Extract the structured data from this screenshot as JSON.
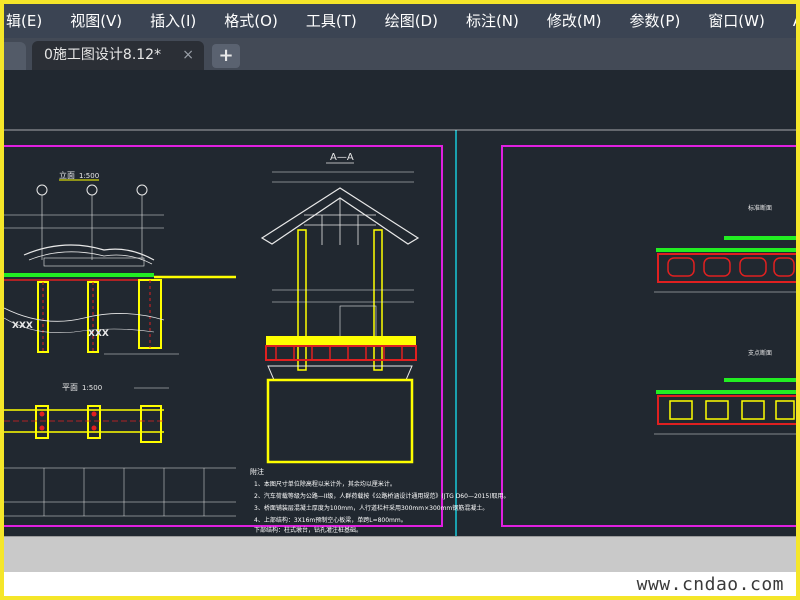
{
  "menu": {
    "items": [
      "辑(E)",
      "视图(V)",
      "插入(I)",
      "格式(O)",
      "工具(T)",
      "绘图(D)",
      "标注(N)",
      "修改(M)",
      "参数(P)",
      "窗口(W)",
      "Acro"
    ]
  },
  "tabs": {
    "active_label": "0施工图设计8.12*",
    "close_glyph": "×",
    "add_glyph": "+"
  },
  "drawing": {
    "section_title": "A—A",
    "plan_title": "立面",
    "plan_scale": "1:500",
    "top_plan_title": "平面",
    "top_plan_scale": "1:500",
    "notes_heading": "附注",
    "notes": [
      "1、本图尺寸单位除高程以米计外，其余均以厘米计。",
      "2、汽车荷载等级为公路—II级，人群荷载按《公路桥涵设计通用规范》(JTG D60—2015)取用。",
      "3、桥面铺装层混凝土厚度为100mm，人行道栏杆采用300mm×300mm钢筋混凝土。",
      "4、上部结构：3X16m预制空心板梁，单跨L=800mm。",
      "   下部结构：柱式墩台，钻孔灌注桩基础。",
      "   其余说明详见总说明。"
    ],
    "right_label_1": "标准断面",
    "right_label_2": "支点断面"
  },
  "colors": {
    "frame": "#f5e629",
    "menubar": "#3b4453",
    "canvas": "#212830",
    "magenta": "#e020e0",
    "cyan": "#19c8d8",
    "yellow": "#ffff00",
    "green": "#22ee22",
    "red": "#e02020",
    "white": "#ffffff"
  },
  "watermark": "www.cndao.com"
}
